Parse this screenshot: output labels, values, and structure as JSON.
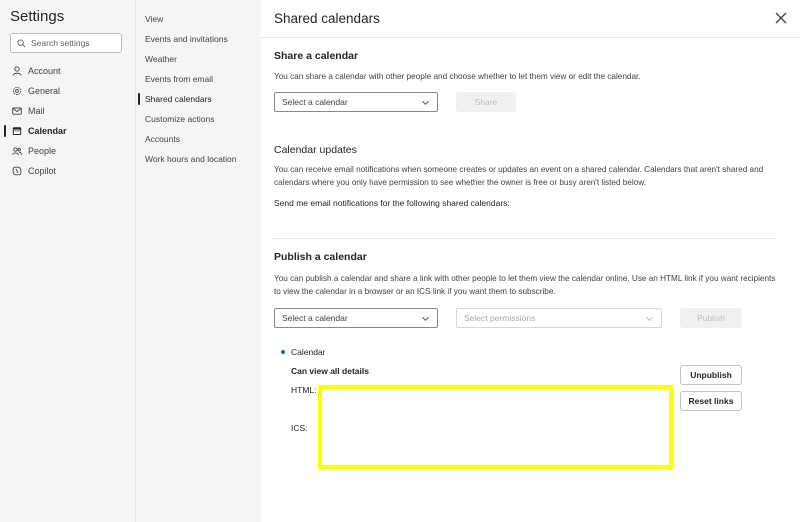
{
  "left": {
    "title": "Settings",
    "search_placeholder": "Search settings",
    "categories": [
      {
        "label": "Account",
        "icon": "person-icon"
      },
      {
        "label": "General",
        "icon": "gear-icon"
      },
      {
        "label": "Mail",
        "icon": "mail-icon"
      },
      {
        "label": "Calendar",
        "icon": "calendar-icon",
        "active": true
      },
      {
        "label": "People",
        "icon": "people-icon"
      },
      {
        "label": "Copilot",
        "icon": "copilot-icon"
      }
    ]
  },
  "middle": {
    "items": [
      {
        "label": "View"
      },
      {
        "label": "Events and invitations"
      },
      {
        "label": "Weather"
      },
      {
        "label": "Events from email"
      },
      {
        "label": "Shared calendars",
        "active": true
      },
      {
        "label": "Customize actions"
      },
      {
        "label": "Accounts"
      },
      {
        "label": "Work hours and location"
      }
    ]
  },
  "main": {
    "title": "Shared calendars",
    "close_icon": "close-icon",
    "share": {
      "title": "Share a calendar",
      "description": "You can share a calendar with other people and choose whether to let them view or edit the calendar.",
      "select_label": "Select a calendar",
      "button_label": "Share"
    },
    "updates": {
      "title": "Calendar updates",
      "description": "You can receive email notifications when someone creates or updates an event on a shared calendar. Calendars that aren't shared and calendars where you only have permission to see whether the owner is free or busy aren't listed below.",
      "notify_label": "Send me email notifications for the following shared calendars:"
    },
    "publish": {
      "title": "Publish a calendar",
      "description": "You can publish a calendar and share a link with other people to let them view the calendar online. Use an HTML link if you want recipients to view the calendar in a browser or an ICS link if you want them to subscribe.",
      "select_label": "Select a calendar",
      "permissions_placeholder": "Select permissions",
      "button_label": "Publish",
      "published": {
        "calendar_name": "Calendar",
        "permission": "Can view all details",
        "html_label": "HTML:",
        "ics_label": "ICS:",
        "unpublish_label": "Unpublish",
        "reset_label": "Reset links"
      }
    }
  },
  "colors": {
    "accent": "#0f6cbd",
    "highlight": "#ffff00",
    "pane_bg": "#f5f5f5"
  }
}
